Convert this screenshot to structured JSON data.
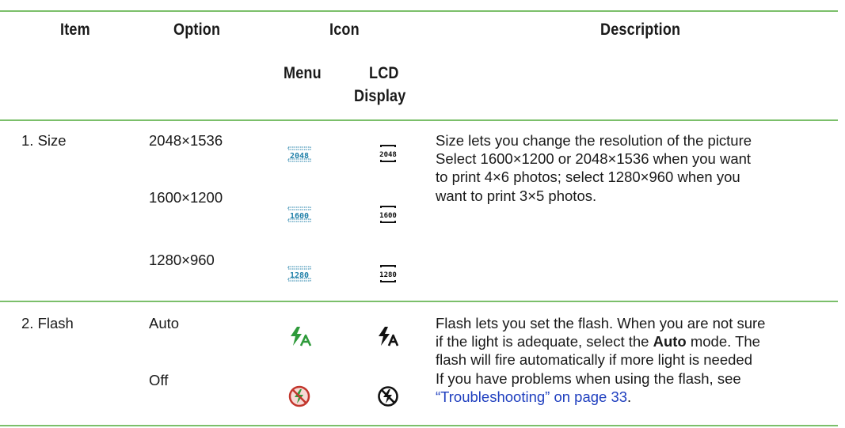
{
  "header": {
    "item": "Item",
    "option": "Option",
    "icon": "Icon",
    "description": "Description",
    "menu": "Menu",
    "lcd_line1": "LCD",
    "lcd_line2": "Display"
  },
  "rows": [
    {
      "item": "1. Size",
      "options": [
        "2048×1536",
        "1600×1200",
        "1280×960"
      ],
      "menu_icons": [
        "size-2048-menu-icon",
        "size-1600-menu-icon",
        "size-1280-menu-icon"
      ],
      "lcd_icons": [
        "size-2048-lcd-icon",
        "size-1600-lcd-icon",
        "size-1280-lcd-icon"
      ],
      "icon_text": [
        "2048",
        "1600",
        "1280"
      ],
      "description_lines": [
        "Size lets you change the resolution of the picture",
        "Select 1600×1200 or 2048×1536 when you want",
        "to print 4×6 photos; select 1280×960 when you",
        "want to print 3×5 photos."
      ]
    },
    {
      "item": "2. Flash",
      "options": [
        "Auto",
        "Off"
      ],
      "menu_icons": [
        "flash-auto-menu-icon",
        "flash-off-menu-icon"
      ],
      "lcd_icons": [
        "flash-auto-lcd-icon",
        "flash-off-lcd-icon"
      ],
      "description": {
        "l1": "Flash lets you set the flash. When you are not sure",
        "l2a": "if the light is adequate, select the ",
        "l2b": "Auto",
        "l2c": " mode. The",
        "l3": "flash will fire automatically if more light is needed",
        "l4": "If you have problems when using the flash, see",
        "link": "“Troubleshooting” on page 33",
        "after_link": "."
      }
    }
  ],
  "colors": {
    "rule": "#7bbf6a",
    "menu_icon": "#1f7fa8",
    "flash_green": "#2e9a3a",
    "link": "#1f3fbf"
  }
}
